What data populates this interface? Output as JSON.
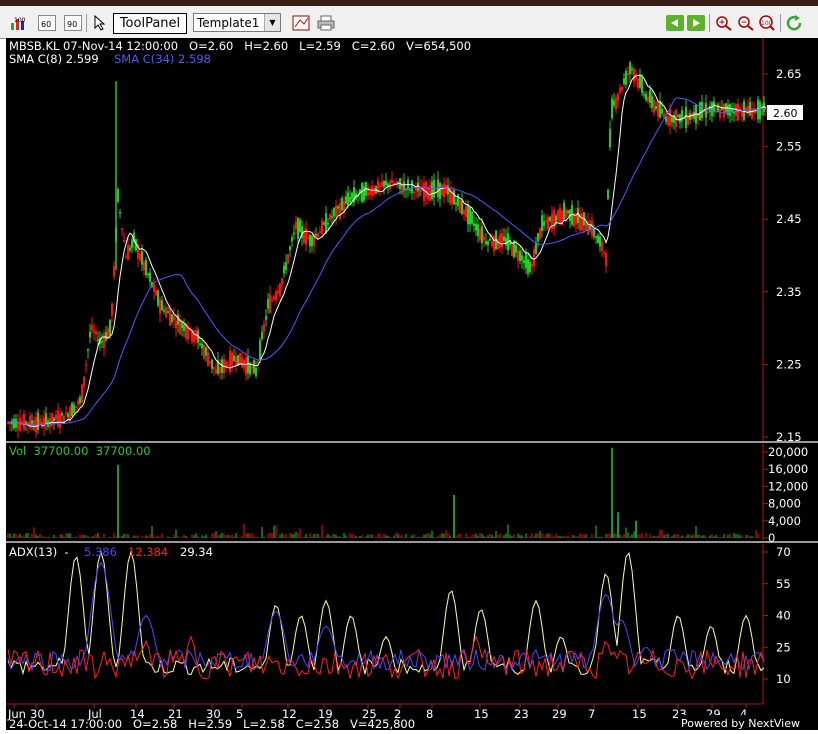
{
  "toolbar": {
    "left_buttons": [
      {
        "name": "bar-chart-icon",
        "label": "100"
      },
      {
        "name": "zoom-60-icon",
        "label": "60"
      },
      {
        "name": "zoom-90-icon",
        "label": "90"
      },
      {
        "name": "pointer-icon",
        "label": ""
      }
    ],
    "toolpanel_label": "ToolPanel",
    "template_value": "Template1",
    "right_buttons": [
      {
        "name": "back-arrow-icon"
      },
      {
        "name": "forward-arrow-icon"
      },
      {
        "name": "zoom-in-icon"
      },
      {
        "name": "zoom-out-icon"
      },
      {
        "name": "zoom-100-icon"
      },
      {
        "name": "refresh-icon"
      }
    ]
  },
  "chart": {
    "header_line": "MBSB.KL 07-Nov-14 12:00:00   O=2.60   H=2.60   L=2.59   C=2.60   V=654,500",
    "sma8_label": "SMA C(8) 2.599",
    "sma34_label": "SMA C(34) 2.598",
    "last_price_tag": "2.60",
    "vol_label": "Vol  37700.00  37700.00",
    "adx_label_prefix": "ADX(13)  - ",
    "adx_val1": "5.386",
    "adx_val2": "12.384",
    "adx_val3": "29.34",
    "footer_bar": "24-Oct-14 17:00:00   O=2.58   H=2.59   L=2.58   C=2.58   V=425,800",
    "powered_by": "Powered by NextView"
  },
  "chart_data": [
    {
      "type": "candlestick",
      "title": "MBSB.KL",
      "ylim": [
        2.15,
        2.68
      ],
      "y_ticks": [
        "2.65",
        "2.55",
        "2.45",
        "2.35",
        "2.25",
        "2.15"
      ],
      "x_tick_labels": [
        "Jun",
        "30",
        "Jul",
        "14",
        "21",
        "30",
        "5",
        "12",
        "19",
        "25",
        "2",
        "8",
        "15",
        "23",
        "29",
        "7",
        "15",
        "23",
        "29",
        "4"
      ],
      "series": [
        {
          "name": "SMA C(8)",
          "last": 2.599
        },
        {
          "name": "SMA C(34)",
          "last": 2.598
        }
      ],
      "price_path": [
        [
          0,
          2.17
        ],
        [
          40,
          2.17
        ],
        [
          60,
          2.18
        ],
        [
          75,
          2.2
        ],
        [
          85,
          2.3
        ],
        [
          95,
          2.28
        ],
        [
          105,
          2.3
        ],
        [
          112,
          2.48
        ],
        [
          120,
          2.4
        ],
        [
          128,
          2.42
        ],
        [
          140,
          2.38
        ],
        [
          155,
          2.33
        ],
        [
          170,
          2.31
        ],
        [
          190,
          2.29
        ],
        [
          210,
          2.24
        ],
        [
          230,
          2.26
        ],
        [
          250,
          2.24
        ],
        [
          262,
          2.33
        ],
        [
          275,
          2.36
        ],
        [
          290,
          2.44
        ],
        [
          305,
          2.42
        ],
        [
          330,
          2.46
        ],
        [
          345,
          2.48
        ],
        [
          365,
          2.49
        ],
        [
          385,
          2.5
        ],
        [
          410,
          2.49
        ],
        [
          440,
          2.49
        ],
        [
          460,
          2.46
        ],
        [
          480,
          2.42
        ],
        [
          500,
          2.42
        ],
        [
          515,
          2.4
        ],
        [
          525,
          2.38
        ],
        [
          535,
          2.44
        ],
        [
          560,
          2.46
        ],
        [
          585,
          2.44
        ],
        [
          600,
          2.4
        ],
        [
          605,
          2.6
        ],
        [
          615,
          2.63
        ],
        [
          625,
          2.66
        ],
        [
          640,
          2.62
        ],
        [
          660,
          2.59
        ],
        [
          680,
          2.59
        ],
        [
          700,
          2.6
        ],
        [
          720,
          2.6
        ],
        [
          745,
          2.6
        ],
        [
          760,
          2.6
        ]
      ]
    },
    {
      "type": "bar",
      "title": "Vol",
      "ylim": [
        0,
        21000
      ],
      "y_ticks": [
        "20,000",
        "16,000",
        "12,000",
        "8,000",
        "4,000",
        "0"
      ],
      "spikes": [
        [
          112,
          17000
        ],
        [
          448,
          10000
        ],
        [
          606,
          21000
        ],
        [
          612,
          6000
        ],
        [
          630,
          4000
        ]
      ]
    },
    {
      "type": "line",
      "title": "ADX(13)",
      "ylim": [
        0,
        72
      ],
      "y_ticks": [
        "70",
        "55",
        "40",
        "25",
        "10"
      ],
      "series": [
        {
          "name": "-",
          "color": "#4848ff",
          "last": 5.386
        },
        {
          "name": "-",
          "color": "#ff2020",
          "last": 12.384
        },
        {
          "name": "ADX",
          "color": "#ffffa0",
          "last": 29.34
        }
      ]
    }
  ],
  "colors": {
    "up": "#22cc22",
    "down": "#ff1010",
    "sma8": "#ffffff",
    "sma34": "#4a5cff",
    "grid_axis": "#b01818",
    "separator": "#9a9a9a"
  }
}
